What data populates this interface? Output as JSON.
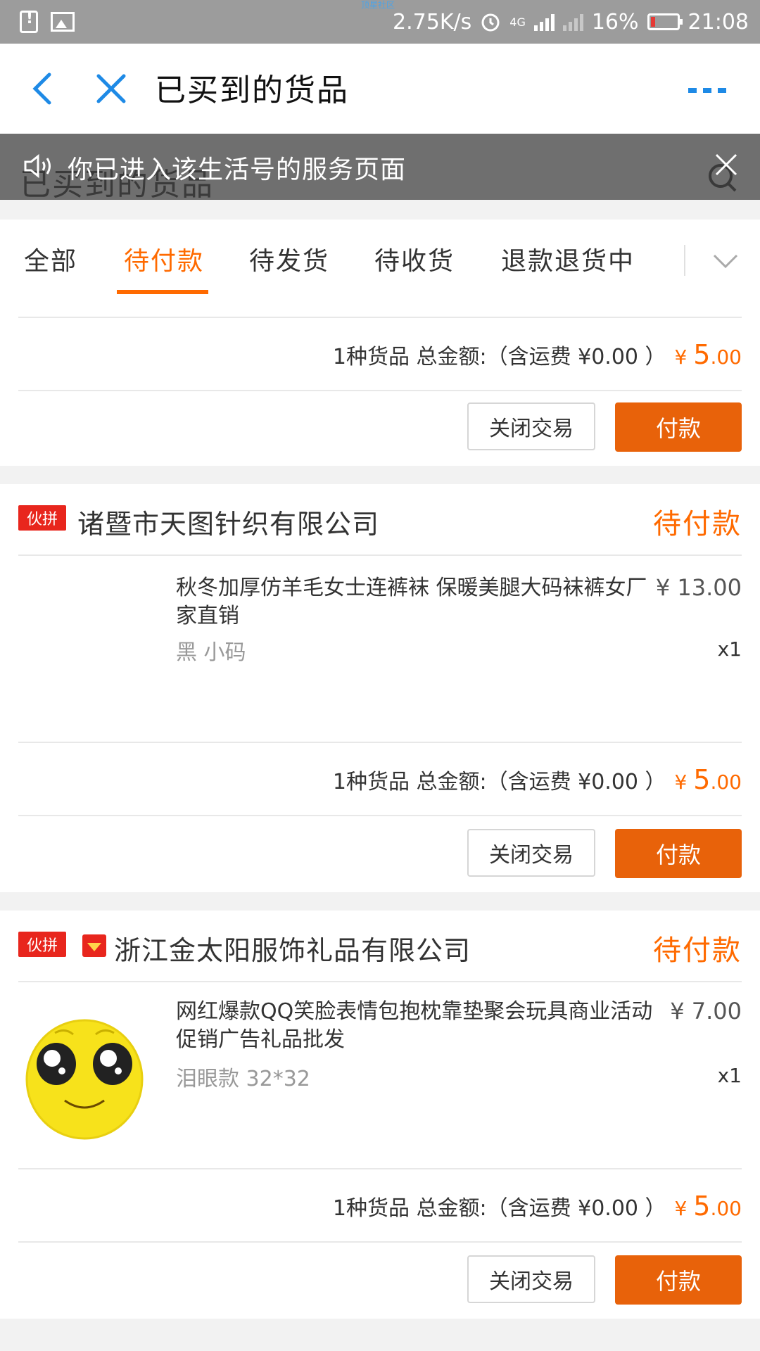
{
  "status_bar": {
    "speed": "2.75K/s",
    "network": "4G",
    "battery": "16%",
    "time": "21:08",
    "brand_watermark": "顶星社区"
  },
  "nav": {
    "title": "已买到的货品"
  },
  "notice": {
    "ghost_title": "已买到的货品",
    "text": "你已进入该生活号的服务页面"
  },
  "tabs": [
    {
      "label": "全部"
    },
    {
      "label": "待付款"
    },
    {
      "label": "待发货"
    },
    {
      "label": "待收货"
    },
    {
      "label": "退款退货中"
    }
  ],
  "active_tab": "待付款",
  "colors": {
    "accent": "#ff6a00",
    "pay_button": "#e8620a",
    "badge": "#e8261d",
    "status_bar": "#9c9c9c",
    "notice_overlay": "#6f6f6f"
  },
  "orders": [
    {
      "summary_prefix": "1种货品 总金额:（含运费 ¥0.00 ）",
      "currency": "¥",
      "amount_int": "5",
      "amount_dec": ".00",
      "close_label": "关闭交易",
      "pay_label": "付款"
    },
    {
      "badge": "伙拼",
      "shop": "诸暨市天图针织有限公司",
      "status": "待付款",
      "item_title": "秋冬加厚仿羊毛女士连裤袜 保暖美腿大码袜裤女厂家直销",
      "item_price": "¥ 13.00",
      "item_sku": "黑 小码",
      "item_qty": "x1",
      "summary_prefix": "1种货品 总金额:（含运费 ¥0.00 ）",
      "currency": "¥",
      "amount_int": "5",
      "amount_dec": ".00",
      "close_label": "关闭交易",
      "pay_label": "付款"
    },
    {
      "badge": "伙拼",
      "shop": "浙江金太阳服饰礼品有限公司",
      "status": "待付款",
      "item_title": "网红爆款QQ笑脸表情包抱枕靠垫聚会玩具商业活动促销广告礼品批发",
      "item_price": "¥ 7.00",
      "item_sku": "泪眼款 32*32",
      "item_qty": "x1",
      "summary_prefix": "1种货品 总金额:（含运费 ¥0.00 ）",
      "currency": "¥",
      "amount_int": "5",
      "amount_dec": ".00",
      "close_label": "关闭交易",
      "pay_label": "付款"
    }
  ]
}
